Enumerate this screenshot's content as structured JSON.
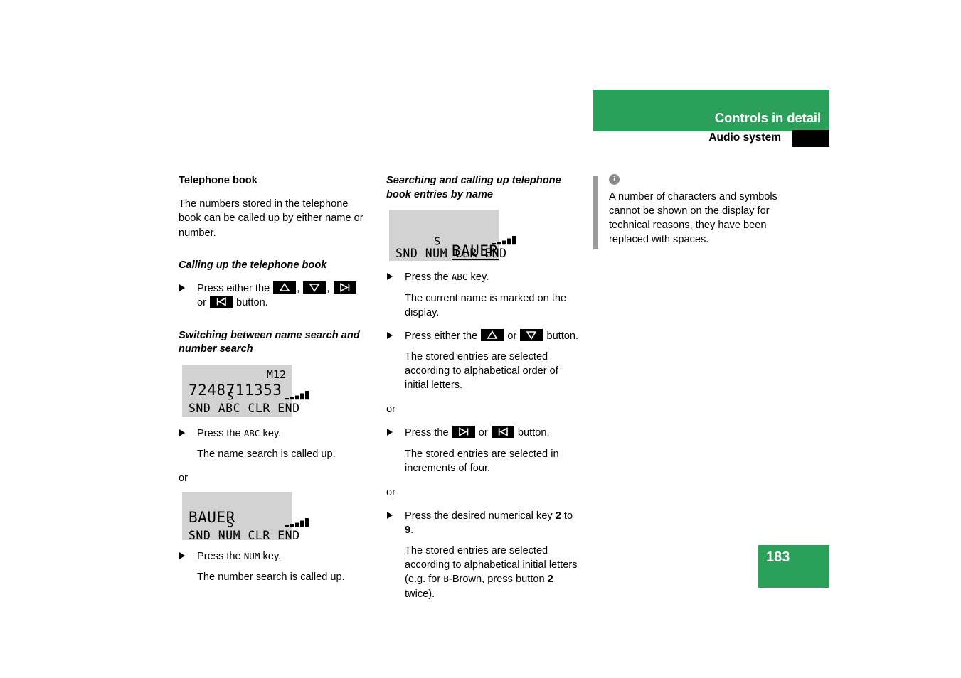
{
  "header": {
    "title": "Controls in detail",
    "subtitle": "Audio system"
  },
  "page_number": "183",
  "colors": {
    "brand_green": "#2aa05a",
    "lcd_background": "#d2d2d2",
    "note_bar_gray": "#9a9a9a"
  },
  "left_column": {
    "section_title": "Telephone book",
    "intro": "The numbers stored in the telephone book can be called up by either name or number.",
    "subsection_1": {
      "title": "Calling up the telephone book",
      "step_prefix": "Press either the",
      "step_mid_1": ",",
      "step_mid_2": ",",
      "step_or": "or",
      "step_suffix": "button."
    },
    "subsection_2": {
      "title": "Switching between name search and number search",
      "display_1": {
        "signal": "S",
        "memory": "M12",
        "line2": "7248711353",
        "line3": "SND ABC CLR END"
      },
      "step_1_prefix": "Press the",
      "step_1_key": "ABC",
      "step_1_suffix": "key.",
      "result_1": "The name search is called up.",
      "or_label": "or",
      "display_2": {
        "signal": "S",
        "line2": "BAUER",
        "line3": "SND NUM CLR END"
      },
      "step_2_prefix": "Press the",
      "step_2_key": "NUM",
      "step_2_suffix": "key.",
      "result_2": "The number search is called up."
    }
  },
  "middle_column": {
    "section_title": "Searching and calling up telephone book entries by name",
    "display": {
      "signal": "S",
      "line2": "BAUER",
      "line3": "SND NUM CLR END"
    },
    "step_1_prefix": "Press the",
    "step_1_key": "ABC",
    "step_1_suffix": "key.",
    "result_1": "The current name is marked on the display.",
    "step_2_prefix": "Press either the",
    "step_2_mid": "or",
    "step_2_suffix": "button.",
    "result_2": "The stored entries are selected according to alphabetical order of initial letters.",
    "or_label_1": "or",
    "step_3_prefix": "Press the",
    "step_3_mid": "or",
    "step_3_suffix": "button.",
    "result_3": "The stored entries are selected in increments of four.",
    "or_label_2": "or",
    "step_4_prefix": "Press the desired numerical key",
    "step_4_num_from": "2",
    "step_4_to": "to",
    "step_4_num_to": "9",
    "step_4_period": ".",
    "result_4_part1": "The stored entries are selected according to alphabetical initial letters (e.g. for",
    "result_4_key": "B",
    "result_4_part2": "-Brown, press button",
    "result_4_num": "2",
    "result_4_part3": "twice)."
  },
  "right_column": {
    "note": "A number of characters and symbols cannot be shown on the display for technical reasons, they have been replaced with spaces."
  },
  "icons": {
    "up": "up-triangle-button",
    "down": "down-triangle-button",
    "next": "skip-next-button",
    "prev": "skip-previous-button",
    "info": "info-icon"
  }
}
